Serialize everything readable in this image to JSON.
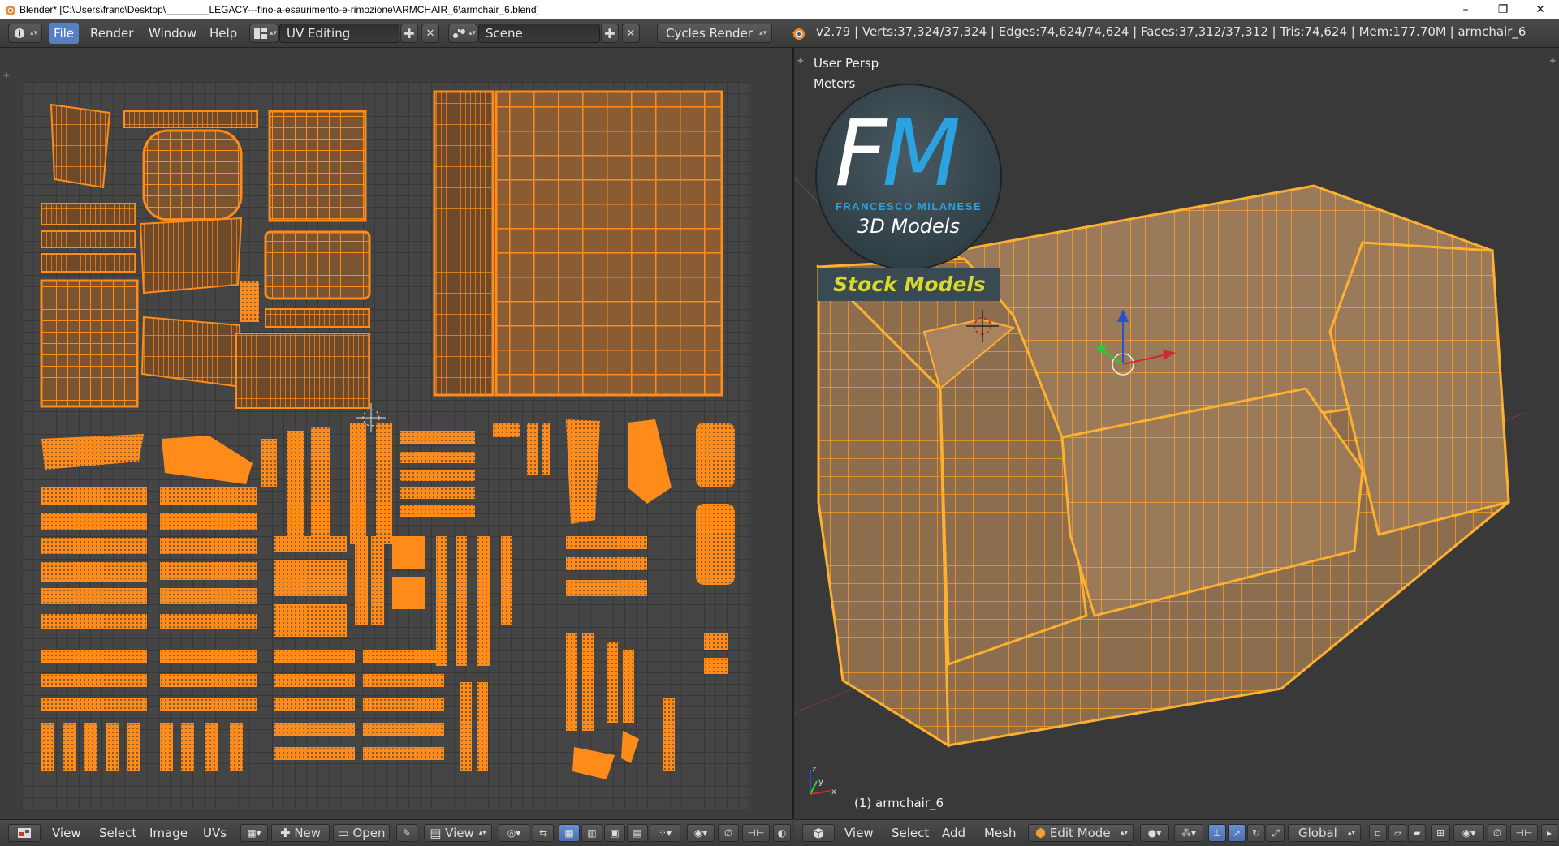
{
  "window": {
    "title": "Blender* [C:\\Users\\franc\\Desktop\\________LEGACY---fino-a-esaurimento-e-rimozione\\ARMCHAIR_6\\armchair_6.blend]",
    "minimize": "–",
    "maximize": "❐",
    "close": "✕"
  },
  "info_header": {
    "menus": [
      "File",
      "Render",
      "Window",
      "Help"
    ],
    "screen_layout": "UV Editing",
    "scene": "Scene",
    "render_engine": "Cycles Render",
    "stats": "v2.79 | Verts:37,324/37,324 | Edges:74,624/74,624 | Faces:37,312/37,312 | Tris:74,624 | Mem:177.70M | armchair_6"
  },
  "viewport": {
    "view_name": "User Persp",
    "units": "Meters",
    "object_label": "(1) armchair_6"
  },
  "logo": {
    "initials_f": "F",
    "initials_m": "M",
    "brand": "FRANCESCO MILANESE",
    "tagline": "3D Models",
    "banner": "Stock Models"
  },
  "uv_header": {
    "menus": [
      "View",
      "Select",
      "Image",
      "UVs"
    ],
    "new_label": "New",
    "open_label": "Open",
    "view_label": "View"
  },
  "viewport_header": {
    "menus": [
      "View",
      "Select",
      "Add",
      "Mesh"
    ],
    "mode": "Edit Mode",
    "orientation": "Global"
  },
  "colors": {
    "accent_orange": "#ff8c1a",
    "selected_blue": "#5680c2",
    "logo_blue": "#2aa3e0",
    "banner_yellow": "#d9d92a"
  }
}
